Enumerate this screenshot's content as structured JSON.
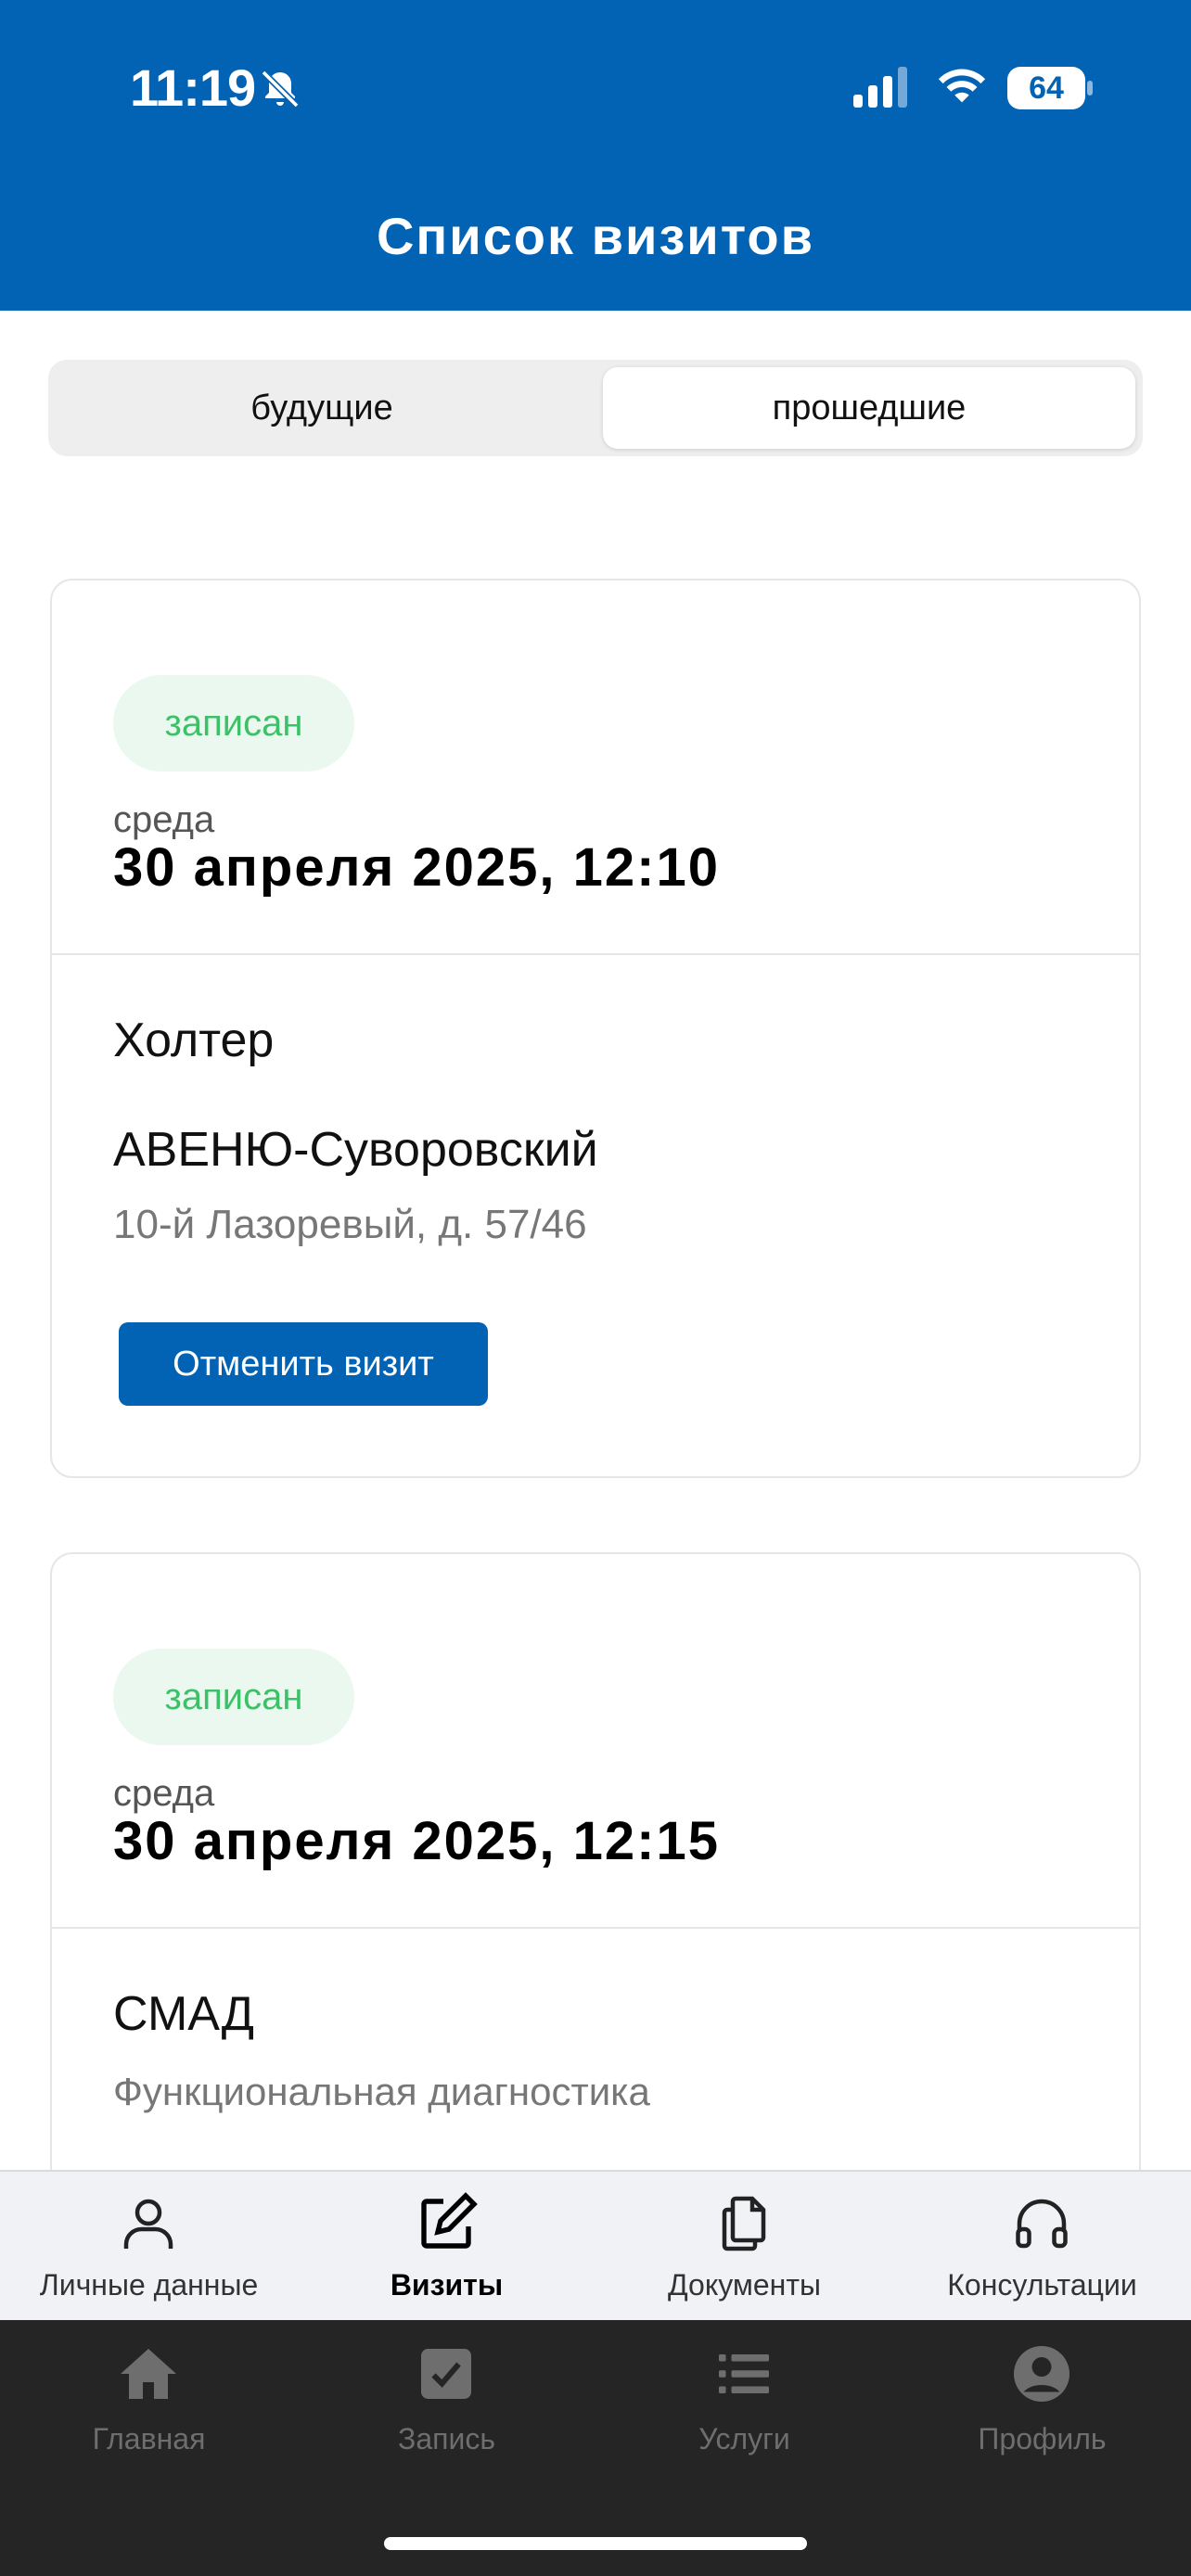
{
  "status_bar": {
    "time": "11:19",
    "battery": "64"
  },
  "header": {
    "title": "Список визитов"
  },
  "segmented": {
    "future": "будущие",
    "past": "прошедшие",
    "selected": "past"
  },
  "visits": [
    {
      "status": "записан",
      "weekday": "среда",
      "datetime": "30 апреля 2025, 12:10",
      "service": "Холтер",
      "clinic": "АВЕНЮ-Суворовский",
      "address": "10-й Лазоревый, д. 57/46",
      "cancel_label": "Отменить визит"
    },
    {
      "status": "записан",
      "weekday": "среда",
      "datetime": "30 апреля 2025, 12:15",
      "service": "СМАД",
      "service_sub": "Функциональная диагностика"
    }
  ],
  "tabbar_top": [
    {
      "label": "Личные данные",
      "icon": "person-icon"
    },
    {
      "label": "Визиты",
      "icon": "edit-icon",
      "active": true
    },
    {
      "label": "Документы",
      "icon": "documents-icon"
    },
    {
      "label": "Консультации",
      "icon": "headphones-icon"
    }
  ],
  "tabbar_bottom": [
    {
      "label": "Главная",
      "icon": "home-icon"
    },
    {
      "label": "Запись",
      "icon": "checkbox-icon"
    },
    {
      "label": "Услуги",
      "icon": "list-icon"
    },
    {
      "label": "Профиль",
      "icon": "profile-icon"
    }
  ],
  "colors": {
    "brand": "#0262B4",
    "status_green": "#3CC168",
    "status_green_bg": "#EAF8EF",
    "bottom_bar": "#252525"
  }
}
